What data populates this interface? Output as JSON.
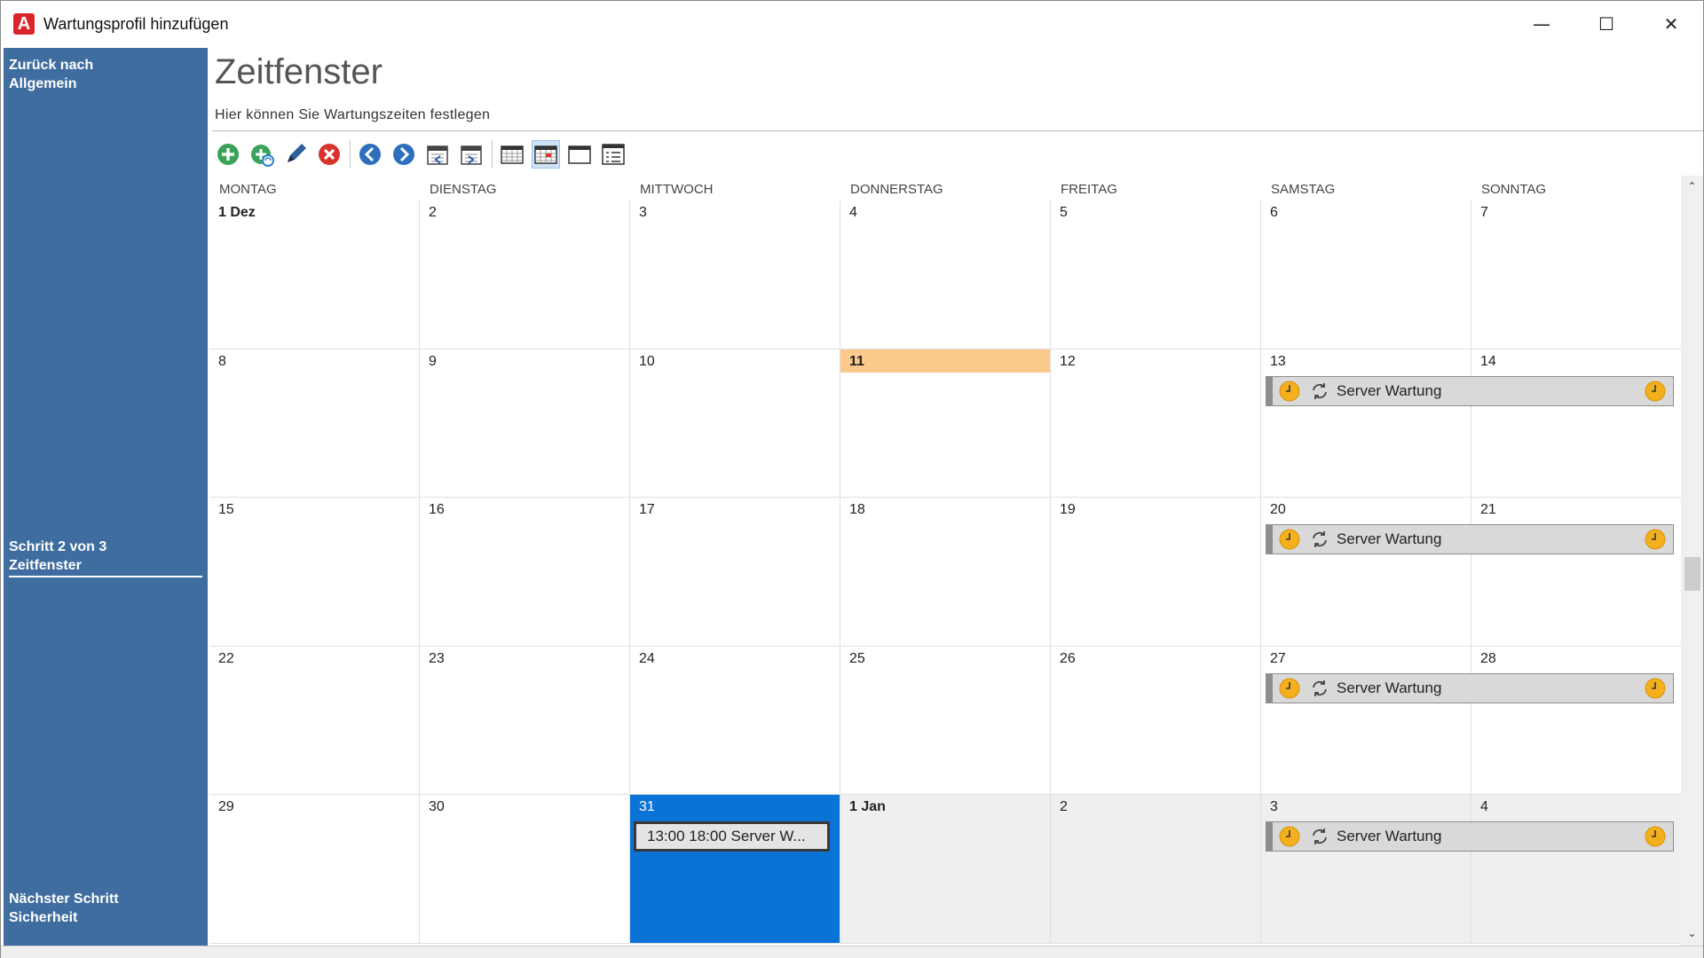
{
  "window": {
    "title": "Wartungsprofil hinzufügen",
    "app_icon": "A",
    "minimize": "—",
    "maximize": "☐",
    "close": "✕"
  },
  "sidebar": {
    "back_line1": "Zurück nach",
    "back_line2": "Allgemein",
    "step_line1": "Schritt 2 von 3",
    "step_line2": "Zeitfenster",
    "next_line1": "Nächster Schritt",
    "next_line2": "Sicherheit",
    "bg_color": "#3f6d9f"
  },
  "main": {
    "title": "Zeitfenster",
    "subtitle": "Hier können Sie Wartungszeiten festlegen"
  },
  "toolbar": {
    "items": [
      "add-icon",
      "add-recurring-icon",
      "edit-icon",
      "delete-icon",
      "back-arrow-icon",
      "forward-arrow-icon",
      "calendar-prev-icon",
      "calendar-next-icon",
      "day-view-icon",
      "month-view-icon",
      "week-view-icon",
      "timeline-view-icon"
    ]
  },
  "calendar": {
    "weekdays": [
      "MONTAG",
      "DIENSTAG",
      "MITTWOCH",
      "DONNERSTAG",
      "FREITAG",
      "SAMSTAG",
      "SONNTAG"
    ],
    "weeks": [
      [
        "1 Dez",
        "2",
        "3",
        "4",
        "5",
        "6",
        "7"
      ],
      [
        "8",
        "9",
        "10",
        "11",
        "12",
        "13",
        "14"
      ],
      [
        "15",
        "16",
        "17",
        "18",
        "19",
        "20",
        "21"
      ],
      [
        "22",
        "23",
        "24",
        "25",
        "26",
        "27",
        "28"
      ],
      [
        "29",
        "30",
        "31",
        "1 Jan",
        "2",
        "3",
        "4"
      ]
    ],
    "today_color": "#fbc98a",
    "selected_color": "#0a74d6",
    "recurring_event_label": "Server Wartung",
    "selected_event_label": "13:00 18:00 Server W..."
  }
}
